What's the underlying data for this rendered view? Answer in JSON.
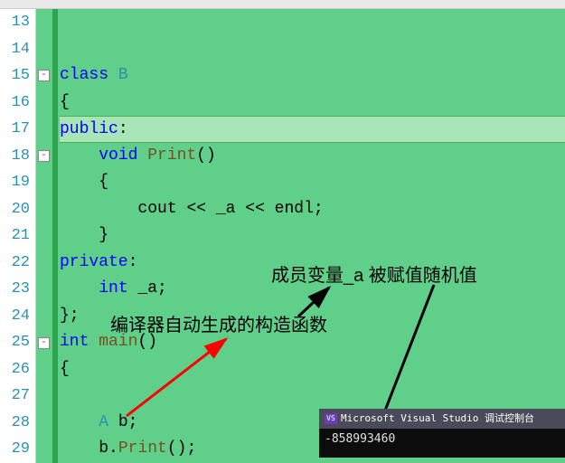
{
  "lineNumbers": [
    "13",
    "14",
    "15",
    "16",
    "17",
    "18",
    "19",
    "20",
    "21",
    "22",
    "23",
    "24",
    "25",
    "26",
    "27",
    "28",
    "29"
  ],
  "code": {
    "l15": {
      "kw": "class",
      "type": " B"
    },
    "l16": "{",
    "l17": {
      "kw": "public",
      "colon": ":"
    },
    "l18": {
      "kw": "void",
      "fn": " Print",
      "rest": "()"
    },
    "l19": "{",
    "l20": {
      "pre": "cout ",
      "op1": "<<",
      "mid": " _a ",
      "op2": "<<",
      "post": " endl;"
    },
    "l21": "}",
    "l22": {
      "kw": "private",
      "colon": ":"
    },
    "l23": {
      "kw": "int",
      "var": " _a;"
    },
    "l24": "};",
    "l25": {
      "kw": "int",
      "fn": " main",
      "rest": "()"
    },
    "l26": "{",
    "l28": {
      "type": "A",
      "rest": " b;"
    },
    "l29": {
      "obj": "b.",
      "fn": "Print",
      "rest": "();"
    }
  },
  "annotations": {
    "member_random": "成员变量_a 被赋值随机值",
    "auto_ctor": "编译器自动生成的构造函数"
  },
  "console": {
    "title": "Microsoft Visual Studio 调试控制台",
    "output": "-858993460"
  },
  "fold_glyph": "-"
}
